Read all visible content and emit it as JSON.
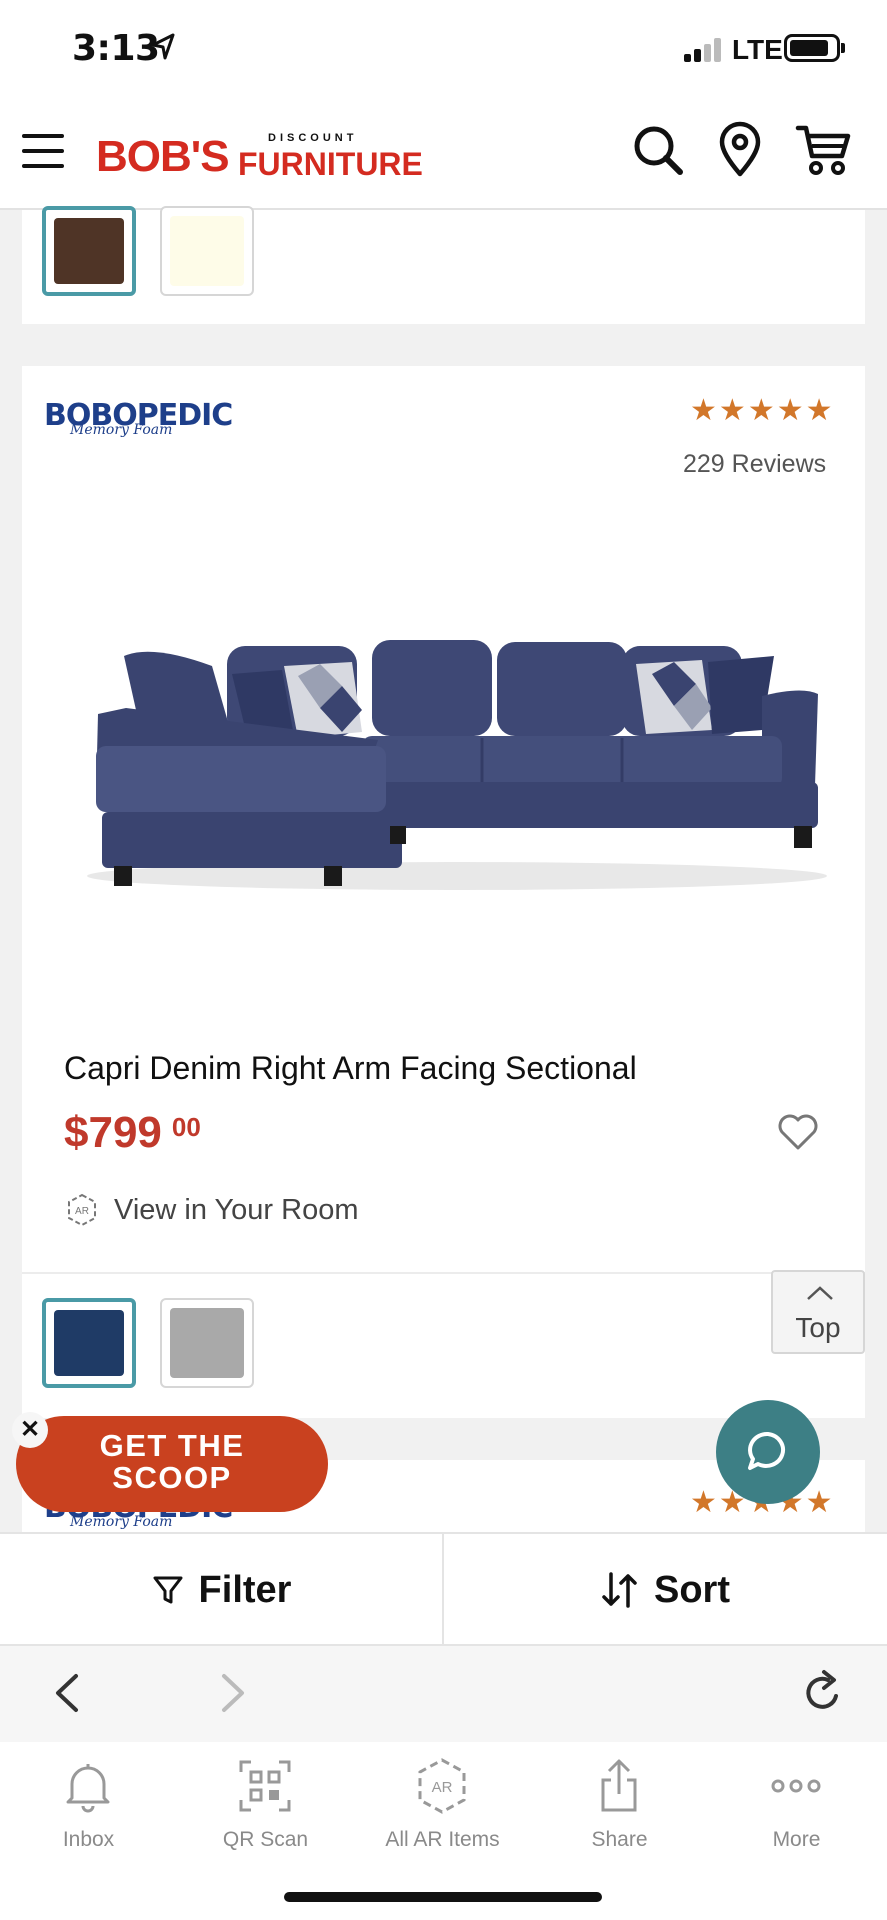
{
  "status_bar": {
    "time": "3:13",
    "network": "LTE"
  },
  "header": {
    "logo_main": "BOB'S",
    "logo_discount": "DISCOUNT",
    "logo_furniture": "FURNITURE"
  },
  "prev_card": {
    "swatches": [
      {
        "color": "#4f3426",
        "selected": true
      },
      {
        "color": "#fefce8",
        "selected": false
      }
    ]
  },
  "product": {
    "brand_logo": "BOBOPEDIC",
    "brand_sub": "Memory Foam",
    "rating": 5,
    "reviews": "229 Reviews",
    "title": "Capri Denim Right Arm Facing Sectional",
    "price_main": "$799",
    "price_cents": "00",
    "ar_label": "View in Your Room",
    "swatches": [
      {
        "color": "#1f3b66",
        "selected": true
      },
      {
        "color": "#a9a9a9",
        "selected": false
      }
    ]
  },
  "next_card": {
    "brand_logo": "BOBOPEDIC",
    "brand_sub": "Memory Foam",
    "rating": 5
  },
  "top_button": {
    "label": "Top"
  },
  "promo": {
    "line1": "GET THE",
    "line2": "SCOOP",
    "close": "✕"
  },
  "filter_sort": {
    "filter_label": "Filter",
    "sort_label": "Sort"
  },
  "tabs": [
    {
      "label": "Inbox",
      "icon": "bell-icon"
    },
    {
      "label": "QR Scan",
      "icon": "qr-scan-icon"
    },
    {
      "label": "All AR Items",
      "icon": "ar-icon"
    },
    {
      "label": "Share",
      "icon": "share-icon"
    },
    {
      "label": "More",
      "icon": "more-icon"
    }
  ],
  "colors": {
    "brand_red": "#d42b20",
    "price_red": "#c0392b",
    "accent_teal": "#4a9aa6",
    "star": "#d2772a",
    "chat": "#3d7f85"
  }
}
